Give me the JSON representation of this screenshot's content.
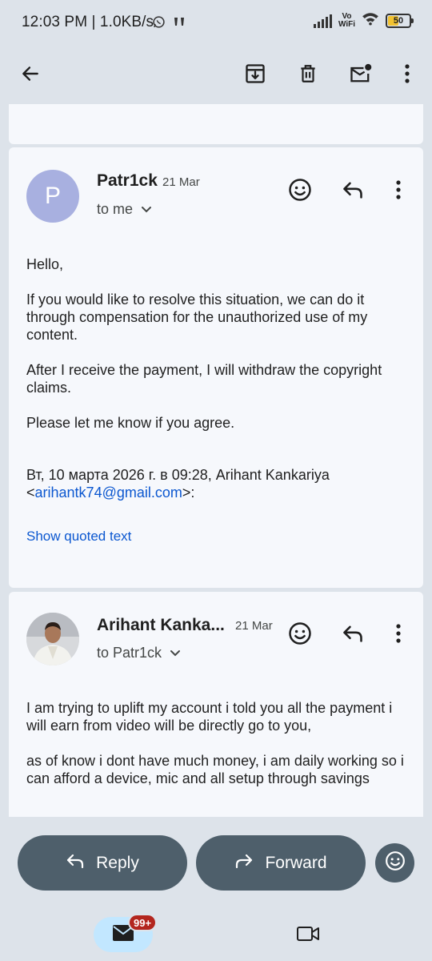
{
  "status_bar": {
    "time_and_speed": "12:03 PM | 1.0KB/s",
    "vowifi_top": "Vo",
    "vowifi_bottom": "WiFi",
    "battery_level": "50"
  },
  "toolbar": {
    "icons": [
      "back-arrow-icon",
      "archive-icon",
      "delete-icon",
      "mark-unread-icon",
      "more-vert-icon"
    ]
  },
  "messages": [
    {
      "avatar_letter": "P",
      "avatar_color": "#a8b0e0",
      "sender": "Patr1ck",
      "date": "21 Mar",
      "recipient": "to me",
      "body": [
        "Hello,",
        "If you would like to resolve this situation, we can do it through compensation for the unauthorized use of my content.",
        "After I receive the payment, I will withdraw the copyright claims.",
        "Please let me know if you agree."
      ],
      "quote_header": "Вт, 10 марта 2026 г. в 09:28, Arihant Kankariya",
      "quote_open": "<",
      "quote_email": "arihantk74@gmail.com",
      "quote_close": ">:",
      "show_quoted": "Show quoted text"
    },
    {
      "sender": "Arihant Kanka...",
      "date": "21 Mar",
      "recipient": "to Patr1ck",
      "body": [
        "I am trying to uplift my account i told you all the payment i will earn from video will be directly go to you,",
        "as of know i dont have much money, i am daily working so i can afford a device, mic and all setup through savings"
      ]
    }
  ],
  "actions": {
    "reply_label": "Reply",
    "forward_label": "Forward"
  },
  "bottom_nav": {
    "mail_badge": "99+"
  },
  "colors": {
    "background": "#dde3ea",
    "card": "#f6f8fc",
    "action_button": "#4e5f6b",
    "link": "#0b57d0",
    "badge": "#b3261e",
    "nav_active_pill": "#c2e7ff"
  }
}
